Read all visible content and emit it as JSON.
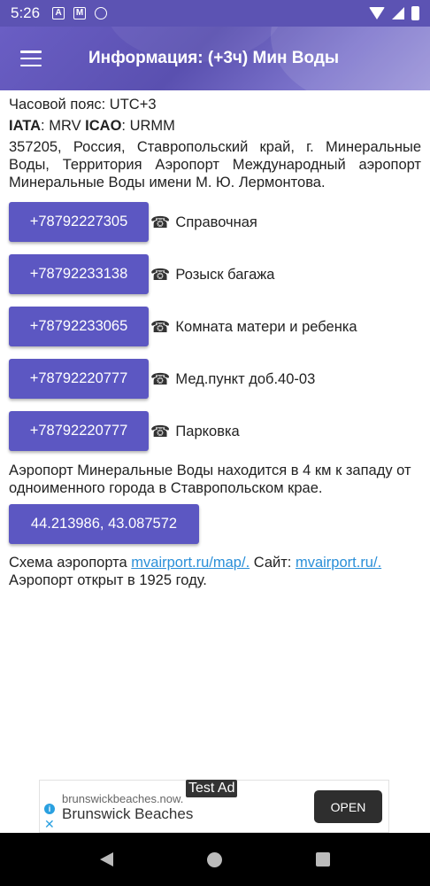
{
  "status_bar": {
    "time": "5:26",
    "icons": [
      "a-icon",
      "mail-icon",
      "sync-icon"
    ]
  },
  "app_bar": {
    "title": "Информация: (+3ч) Мин Воды"
  },
  "info": {
    "timezone": "Часовой пояс: UTC+3",
    "iata_label": "IATA",
    "iata_value": ": MRV ",
    "icao_label": "ICAO",
    "icao_value": ": URMM",
    "address": "357205, Россия, Ставропольский край, г. Минеральные Воды, Территория Аэропорт Международный аэропорт Минеральные Воды имени М. Ю. Лермонтова."
  },
  "phones": [
    {
      "number": "+78792227305",
      "label": "Справочная"
    },
    {
      "number": "+78792233138",
      "label": "Розыск багажа"
    },
    {
      "number": "+78792233065",
      "label": "Комната матери и ребенка"
    },
    {
      "number": "+78792220777",
      "label": "Мед.пункт доб.40-03"
    },
    {
      "number": "+78792220777",
      "label": "Парковка"
    }
  ],
  "phone_glyph": "☎",
  "description": "Аэропорт Минеральные Воды находится в 4 км к западу от одноименного города в Ставропольском крае.",
  "coordinates": "44.213986, 43.087572",
  "footer": {
    "scheme_label": "Схема аэропорта ",
    "scheme_link": "mvairport.ru/map/.",
    "site_label": " Сайт: ",
    "site_link": "mvairport.ru/.",
    "opened": "Аэропорт открыт в 1925 году."
  },
  "ad": {
    "tag": "Test Ad",
    "domain": "brunswickbeaches.now.",
    "title": "Brunswick Beaches",
    "button": "OPEN",
    "close_glyph": "✕",
    "info_glyph": "i"
  },
  "colors": {
    "accent": "#5c57c2",
    "app_bar": "#5a50b0",
    "link": "#2a8fd8"
  }
}
